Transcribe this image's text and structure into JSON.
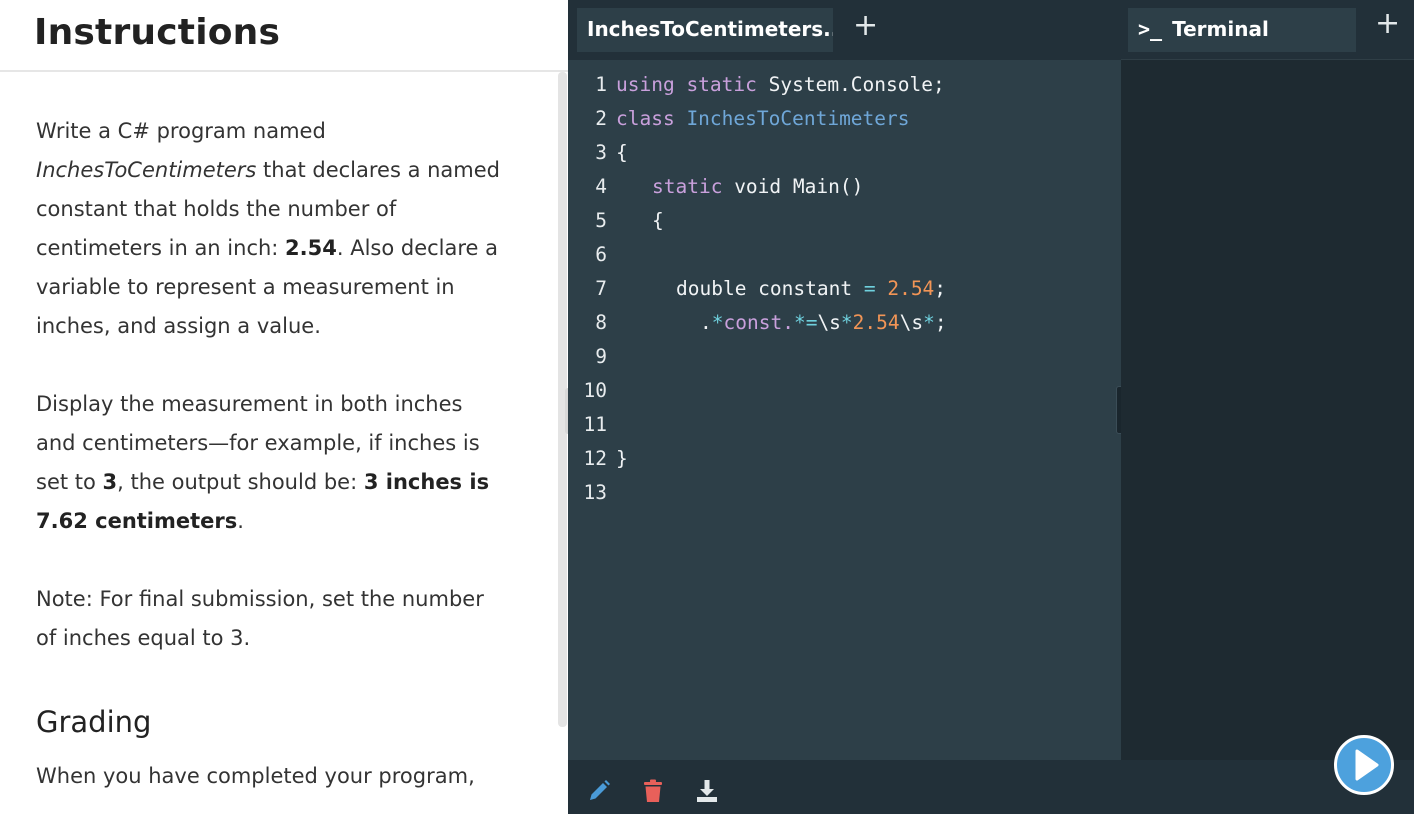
{
  "instructions": {
    "title": "Instructions",
    "p1_a": "Write a C# program named ",
    "p1_em": "InchesToCentimeters",
    "p1_b": " that declares a named constant that holds the number of centimeters in an inch: ",
    "p1_bold": "2.54",
    "p1_c": ". Also declare a variable to represent a measurement in inches, and assign a value.",
    "p2_a": "Display the measurement in both inches and centimeters—for example, if inches is set to ",
    "p2_bold1": "3",
    "p2_b": ", the output should be: ",
    "p2_bold2": "3 inches is 7.62 centimeters",
    "p2_c": ".",
    "p3": "Note: For final submission, set the number of inches equal to 3.",
    "grading_heading": "Grading",
    "grading_text": "When you have completed your program,"
  },
  "editor": {
    "tab_label": "InchesToCentimeters...",
    "add_tab_label": "+",
    "lines": [
      {
        "n": "1"
      },
      {
        "n": "2"
      },
      {
        "n": "3"
      },
      {
        "n": "4"
      },
      {
        "n": "5"
      },
      {
        "n": "6"
      },
      {
        "n": "7"
      },
      {
        "n": "8"
      },
      {
        "n": "9"
      },
      {
        "n": "10"
      },
      {
        "n": "11"
      },
      {
        "n": "12"
      },
      {
        "n": "13"
      }
    ],
    "code": {
      "l1_kw": "using static",
      "l1_rest": " System.Console;",
      "l2_kw": "class",
      "l2_cls": " InchesToCentimeters",
      "l3": "{",
      "l4_kw": "static",
      "l4_rest": " void Main()",
      "l5": "{",
      "l7_a": "double constant ",
      "l7_op": "=",
      "l7_num": " 2.54",
      "l7_end": ";",
      "l8_a": ".",
      "l8_op1": "*",
      "l8_b": "const.",
      "l8_op2": "*=",
      "l8_c": "\\s",
      "l8_op3": "*",
      "l8_num": "2.54",
      "l8_d": "\\s",
      "l8_op4": "*",
      "l8_end": ";",
      "l12": "}"
    },
    "footer_tools": [
      "pencil-icon",
      "trash-icon",
      "download-icon"
    ]
  },
  "terminal": {
    "prompt_glyph": ">_",
    "tab_label": "Terminal",
    "add_label": "+"
  },
  "colors": {
    "editor_bg": "#2d3f48",
    "tab_bar_bg": "#223039",
    "keyword": "#c9a0dc",
    "class_name": "#6fa7d8",
    "number": "#f29556",
    "operator": "#6fd1de",
    "run_button": "#4da1dd",
    "pencil": "#4a9bd8",
    "trash": "#e8605a"
  }
}
